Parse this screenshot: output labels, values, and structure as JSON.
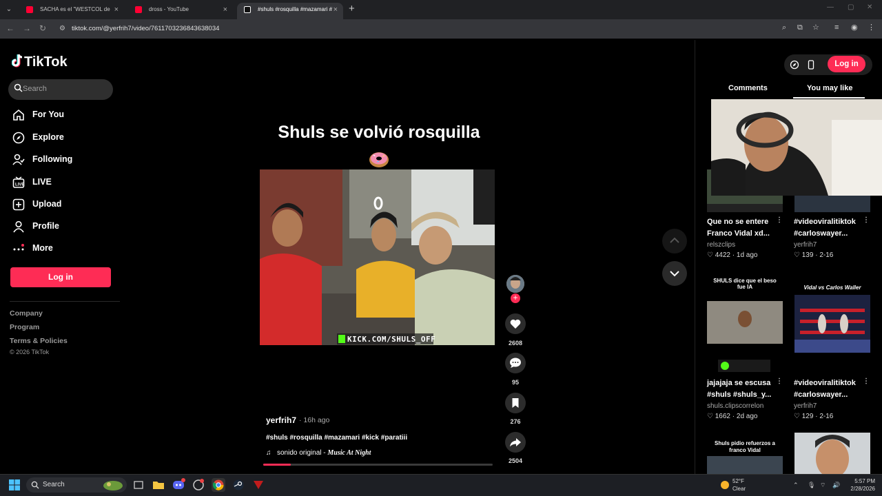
{
  "browser": {
    "tabs": [
      {
        "title": "SACHA es el \"WESTCOL de",
        "favicon_color": "#ff0033"
      },
      {
        "title": "dross - YouTube",
        "favicon_color": "#ff0033"
      },
      {
        "title": "#shuls #rosquilla #mazamari #",
        "favicon_color": "#ffffff",
        "active": true
      }
    ],
    "url": "tiktok.com/@yerfrih7/video/7611703236843638034"
  },
  "sidebar": {
    "logo": "TikTok",
    "search_placeholder": "Search",
    "nav": [
      {
        "label": "For You",
        "icon": "home-icon"
      },
      {
        "label": "Explore",
        "icon": "compass-icon"
      },
      {
        "label": "Following",
        "icon": "following-icon"
      },
      {
        "label": "LIVE",
        "icon": "live-icon"
      },
      {
        "label": "Upload",
        "icon": "upload-icon"
      },
      {
        "label": "Profile",
        "icon": "profile-icon"
      },
      {
        "label": "More",
        "icon": "more-icon"
      }
    ],
    "login_label": "Log in",
    "footer_links": [
      "Company",
      "Program",
      "Terms & Policies"
    ],
    "copyright": "© 2026 TikTok"
  },
  "video": {
    "title": "Shuls se volvió rosquilla",
    "watermark": "KICK.COM/SHULS_OFF",
    "author": "yerfrih7",
    "posted": "· 16h ago",
    "hashtags": "#shuls #rosquilla #mazamari #kick #paratiii",
    "music_label": "sonido original -",
    "music_artist": "Music At Night",
    "progress_fraction": 0.12,
    "actions": {
      "likes": "2608",
      "comments": "95",
      "saves": "276",
      "shares": "2504"
    }
  },
  "right_panel": {
    "login_label": "Log in",
    "tabs": [
      "Comments",
      "You may like"
    ],
    "cards": [
      {
        "title": "Que no se entere Franco Vidal xd...",
        "author": "relszclips",
        "likes": "4422",
        "date": "· 1d ago"
      },
      {
        "title": "#videoviralitiktok #carloswayer...",
        "author": "yerfrih7",
        "likes": "139",
        "date": "· 2-16"
      },
      {
        "title": "jajajaja se escusa #shuls #shuls_y...",
        "author": "shuls.clipscorrelon",
        "likes": "1662",
        "date": "· 2d ago",
        "thumb_caption": "SHULS dice que el beso fue IA"
      },
      {
        "title": "#videoviralitiktok #carloswayer...",
        "author": "yerfrih7",
        "likes": "129",
        "date": "· 2-16",
        "thumb_caption": "Vidal vs Carlos Waller"
      },
      {
        "thumb_caption": "Shuls pidio refuerzos a franco Vidal"
      }
    ]
  },
  "taskbar": {
    "search_label": "Search",
    "weather_temp": "52°F",
    "weather_desc": "Clear",
    "time": "5:57 PM",
    "date": "2/28/2026"
  }
}
